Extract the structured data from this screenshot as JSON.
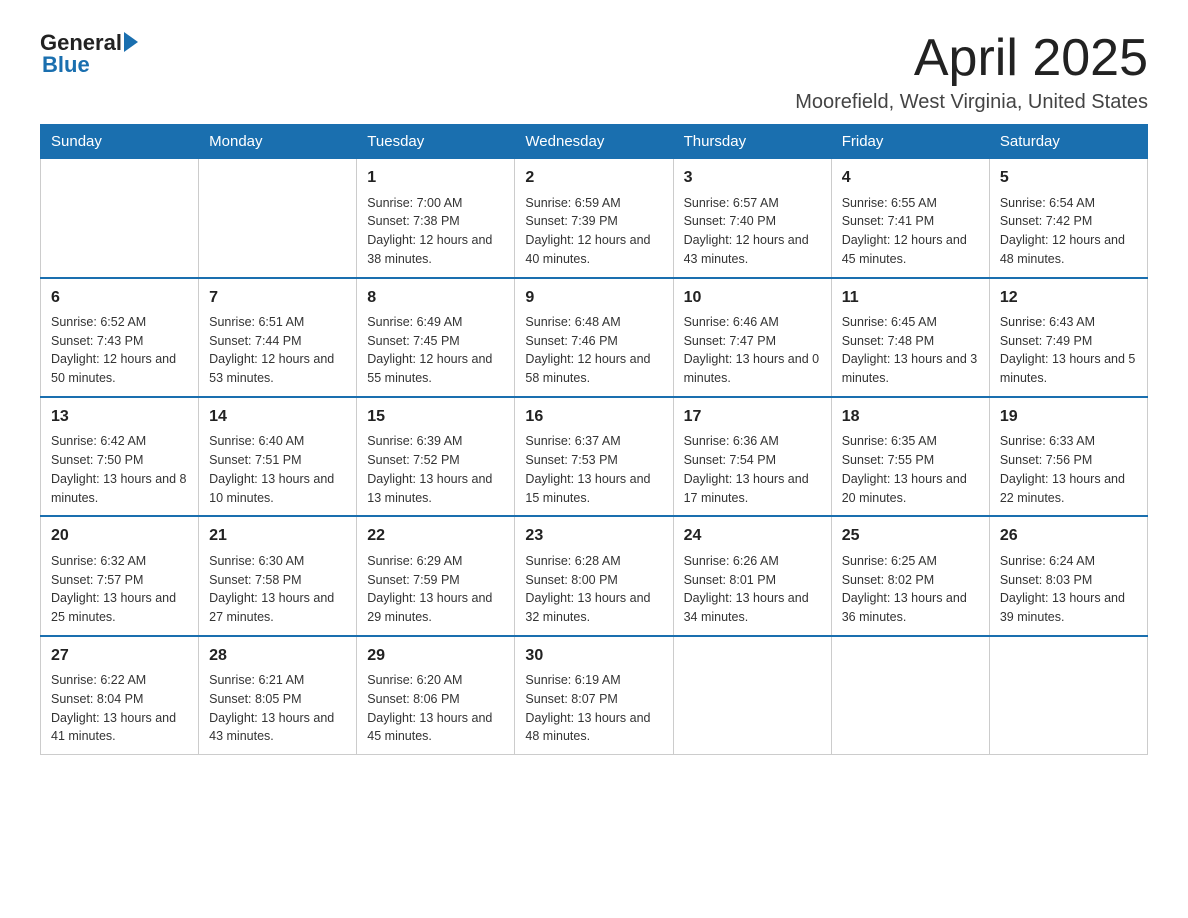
{
  "logo": {
    "general": "General",
    "blue": "Blue",
    "arrow": "▶"
  },
  "title": {
    "month": "April 2025",
    "location": "Moorefield, West Virginia, United States"
  },
  "headers": [
    "Sunday",
    "Monday",
    "Tuesday",
    "Wednesday",
    "Thursday",
    "Friday",
    "Saturday"
  ],
  "weeks": [
    [
      {
        "day": "",
        "info": ""
      },
      {
        "day": "",
        "info": ""
      },
      {
        "day": "1",
        "info": "Sunrise: 7:00 AM\nSunset: 7:38 PM\nDaylight: 12 hours\nand 38 minutes."
      },
      {
        "day": "2",
        "info": "Sunrise: 6:59 AM\nSunset: 7:39 PM\nDaylight: 12 hours\nand 40 minutes."
      },
      {
        "day": "3",
        "info": "Sunrise: 6:57 AM\nSunset: 7:40 PM\nDaylight: 12 hours\nand 43 minutes."
      },
      {
        "day": "4",
        "info": "Sunrise: 6:55 AM\nSunset: 7:41 PM\nDaylight: 12 hours\nand 45 minutes."
      },
      {
        "day": "5",
        "info": "Sunrise: 6:54 AM\nSunset: 7:42 PM\nDaylight: 12 hours\nand 48 minutes."
      }
    ],
    [
      {
        "day": "6",
        "info": "Sunrise: 6:52 AM\nSunset: 7:43 PM\nDaylight: 12 hours\nand 50 minutes."
      },
      {
        "day": "7",
        "info": "Sunrise: 6:51 AM\nSunset: 7:44 PM\nDaylight: 12 hours\nand 53 minutes."
      },
      {
        "day": "8",
        "info": "Sunrise: 6:49 AM\nSunset: 7:45 PM\nDaylight: 12 hours\nand 55 minutes."
      },
      {
        "day": "9",
        "info": "Sunrise: 6:48 AM\nSunset: 7:46 PM\nDaylight: 12 hours\nand 58 minutes."
      },
      {
        "day": "10",
        "info": "Sunrise: 6:46 AM\nSunset: 7:47 PM\nDaylight: 13 hours\nand 0 minutes."
      },
      {
        "day": "11",
        "info": "Sunrise: 6:45 AM\nSunset: 7:48 PM\nDaylight: 13 hours\nand 3 minutes."
      },
      {
        "day": "12",
        "info": "Sunrise: 6:43 AM\nSunset: 7:49 PM\nDaylight: 13 hours\nand 5 minutes."
      }
    ],
    [
      {
        "day": "13",
        "info": "Sunrise: 6:42 AM\nSunset: 7:50 PM\nDaylight: 13 hours\nand 8 minutes."
      },
      {
        "day": "14",
        "info": "Sunrise: 6:40 AM\nSunset: 7:51 PM\nDaylight: 13 hours\nand 10 minutes."
      },
      {
        "day": "15",
        "info": "Sunrise: 6:39 AM\nSunset: 7:52 PM\nDaylight: 13 hours\nand 13 minutes."
      },
      {
        "day": "16",
        "info": "Sunrise: 6:37 AM\nSunset: 7:53 PM\nDaylight: 13 hours\nand 15 minutes."
      },
      {
        "day": "17",
        "info": "Sunrise: 6:36 AM\nSunset: 7:54 PM\nDaylight: 13 hours\nand 17 minutes."
      },
      {
        "day": "18",
        "info": "Sunrise: 6:35 AM\nSunset: 7:55 PM\nDaylight: 13 hours\nand 20 minutes."
      },
      {
        "day": "19",
        "info": "Sunrise: 6:33 AM\nSunset: 7:56 PM\nDaylight: 13 hours\nand 22 minutes."
      }
    ],
    [
      {
        "day": "20",
        "info": "Sunrise: 6:32 AM\nSunset: 7:57 PM\nDaylight: 13 hours\nand 25 minutes."
      },
      {
        "day": "21",
        "info": "Sunrise: 6:30 AM\nSunset: 7:58 PM\nDaylight: 13 hours\nand 27 minutes."
      },
      {
        "day": "22",
        "info": "Sunrise: 6:29 AM\nSunset: 7:59 PM\nDaylight: 13 hours\nand 29 minutes."
      },
      {
        "day": "23",
        "info": "Sunrise: 6:28 AM\nSunset: 8:00 PM\nDaylight: 13 hours\nand 32 minutes."
      },
      {
        "day": "24",
        "info": "Sunrise: 6:26 AM\nSunset: 8:01 PM\nDaylight: 13 hours\nand 34 minutes."
      },
      {
        "day": "25",
        "info": "Sunrise: 6:25 AM\nSunset: 8:02 PM\nDaylight: 13 hours\nand 36 minutes."
      },
      {
        "day": "26",
        "info": "Sunrise: 6:24 AM\nSunset: 8:03 PM\nDaylight: 13 hours\nand 39 minutes."
      }
    ],
    [
      {
        "day": "27",
        "info": "Sunrise: 6:22 AM\nSunset: 8:04 PM\nDaylight: 13 hours\nand 41 minutes."
      },
      {
        "day": "28",
        "info": "Sunrise: 6:21 AM\nSunset: 8:05 PM\nDaylight: 13 hours\nand 43 minutes."
      },
      {
        "day": "29",
        "info": "Sunrise: 6:20 AM\nSunset: 8:06 PM\nDaylight: 13 hours\nand 45 minutes."
      },
      {
        "day": "30",
        "info": "Sunrise: 6:19 AM\nSunset: 8:07 PM\nDaylight: 13 hours\nand 48 minutes."
      },
      {
        "day": "",
        "info": ""
      },
      {
        "day": "",
        "info": ""
      },
      {
        "day": "",
        "info": ""
      }
    ]
  ]
}
